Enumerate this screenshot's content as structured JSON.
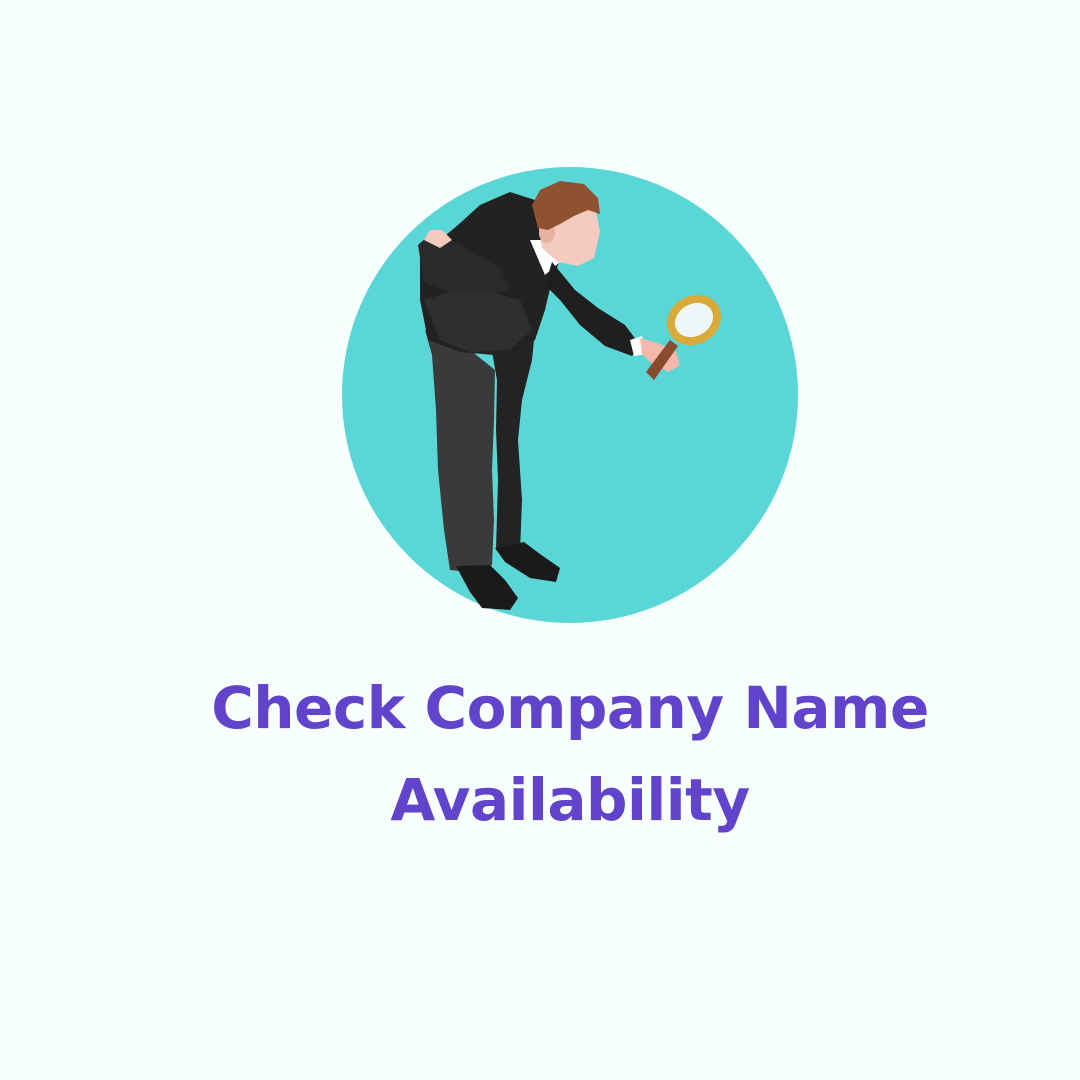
{
  "headline": {
    "line1": "Check Company Name",
    "line2": "Availability"
  },
  "illustration": {
    "icon": "detective-with-magnifying-glass-icon",
    "background_circle_color": "#5bd6d6"
  },
  "colors": {
    "page_background": "#f7fffe",
    "headline": "#6244cc",
    "suit": "#222222",
    "trousers": "#3a3a3a",
    "hair": "#8f5230",
    "skin": "#f6cbbf",
    "magnifier_rim": "#d9a93a",
    "magnifier_handle": "#8a4a2c"
  }
}
